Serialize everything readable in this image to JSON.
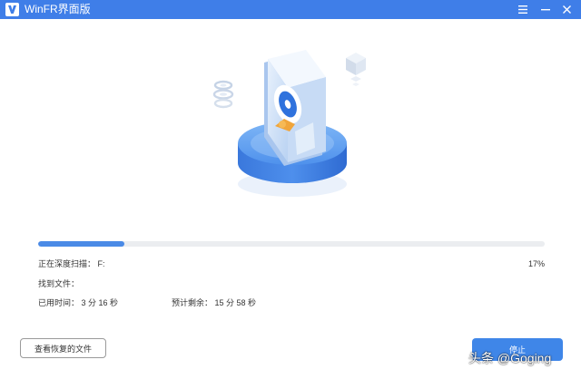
{
  "window": {
    "title": "WinFR界面版",
    "logo_icon": "app-logo-icon",
    "controls": [
      "menu-icon",
      "minimize-icon",
      "close-icon"
    ]
  },
  "colors": {
    "titlebar": "#3f7ee8",
    "accent": "#4a8ae6",
    "track": "#ebedf0"
  },
  "scan": {
    "status_label": "正在深度扫描：",
    "drive": "F:",
    "status_text": "正在深度扫描：  F:",
    "percent_text": "17%",
    "progress": 0.17,
    "found_label": "找到文件：",
    "elapsed_label": "已用时间：",
    "elapsed_value": "3 分 16 秒",
    "elapsed_text": "已用时间：  3 分 16 秒",
    "remaining_label": "预计剩余：",
    "remaining_value": "15 分 58 秒",
    "remaining_text": "预计剩余：  15 分 58 秒"
  },
  "buttons": {
    "view_recovered": "查看恢复的文件",
    "stop": "停止"
  },
  "watermark": "头条 @Goging"
}
